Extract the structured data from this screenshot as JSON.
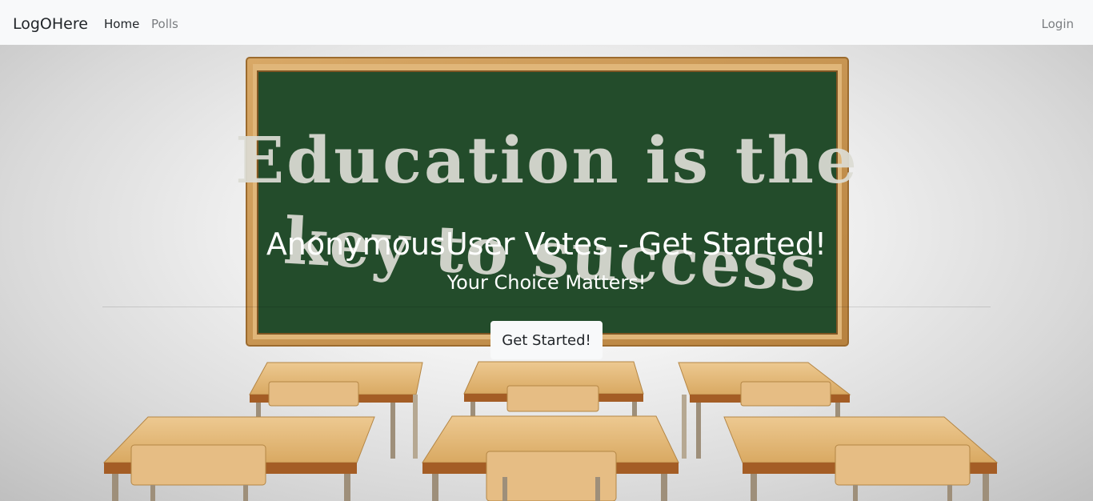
{
  "navbar": {
    "brand": "LogOHere",
    "links": [
      {
        "label": "Home",
        "active": true
      },
      {
        "label": "Polls",
        "active": false
      }
    ],
    "login_label": "Login"
  },
  "hero": {
    "chalkboard_text_line1": "Education is the",
    "chalkboard_text_line2": "key to success",
    "title": "AnonymousUser Votes - Get Started!",
    "subtitle": "Your Choice Matters!",
    "cta_label": "Get Started!"
  },
  "colors": {
    "navbar_bg": "#f8f9fa",
    "chalkboard_green": "#234c2b",
    "board_frame": "#c9975a",
    "desk_wood": "#e3b878",
    "text_white": "#ffffff",
    "button_bg": "#f8f9fa"
  }
}
